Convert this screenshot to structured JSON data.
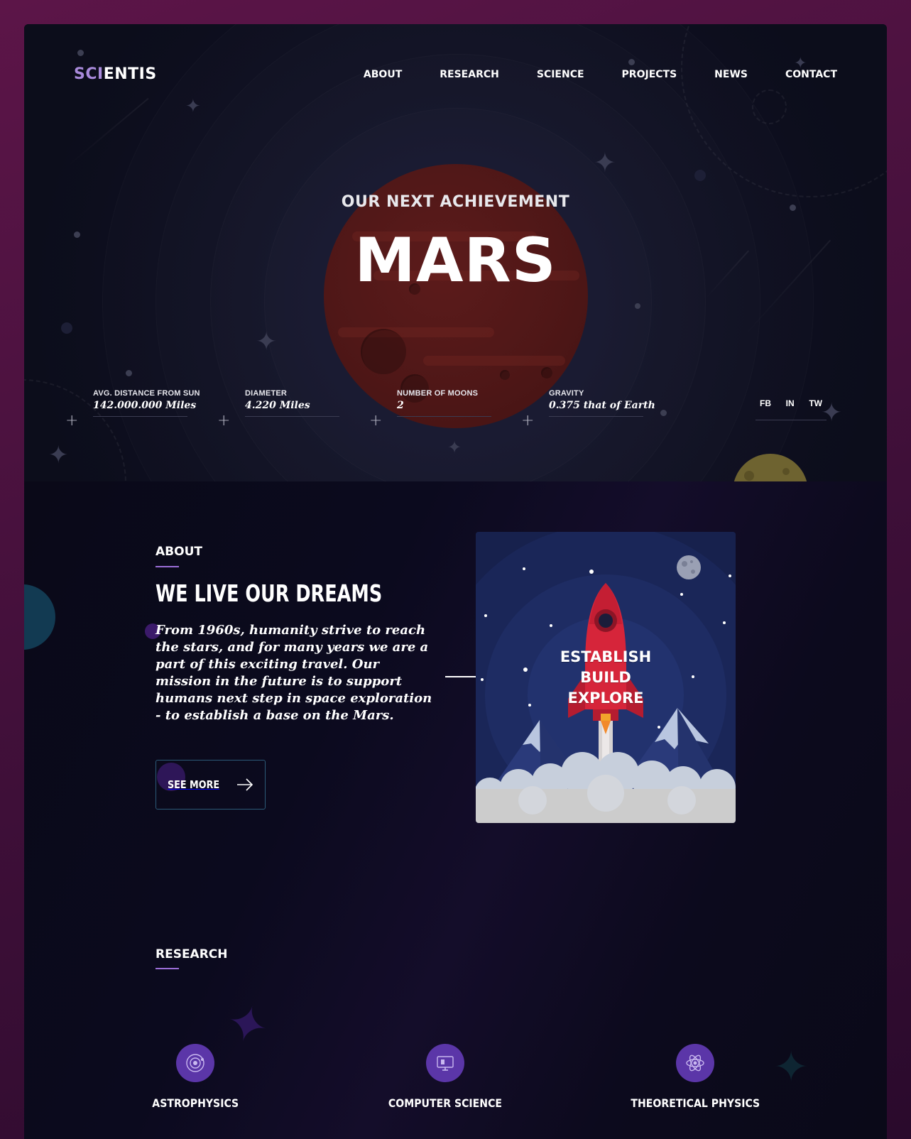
{
  "brand": {
    "logo_accent": "SCI",
    "logo_rest": "ENTIS",
    "accent_color": "#a98adb"
  },
  "nav": {
    "items": [
      "ABOUT",
      "RESEARCH",
      "SCIENCE",
      "PROJECTS",
      "NEWS",
      "CONTACT"
    ]
  },
  "hero": {
    "eyebrow": "OUR NEXT ACHIEVEMENT",
    "title": "MARS",
    "stats": [
      {
        "label": "AVG. DISTANCE FROM SUN",
        "value": "142.000.000 Miles"
      },
      {
        "label": "DIAMETER",
        "value": "4.220 Miles"
      },
      {
        "label": "NUMBER OF MOONS",
        "value": "2"
      },
      {
        "label": "GRAVITY",
        "value": "0.375 that of Earth"
      }
    ],
    "social": [
      "FB",
      "IN",
      "TW"
    ]
  },
  "about": {
    "label": "ABOUT",
    "heading": "WE LIVE OUR DREAMS",
    "text": "From 1960s, humanity strive to reach the stars, and for many years we are a part of this exciting travel. Our mission in the future is to support humans next step in space exploration - to establish a base on the Mars.",
    "button_label": "SEE MORE",
    "illustration_lines": [
      "ESTABLISH",
      "BUILD",
      "EXPLORE"
    ]
  },
  "research": {
    "label": "RESEARCH",
    "items": [
      {
        "name": "ASTROPHYSICS",
        "icon": "orbit-icon"
      },
      {
        "name": "COMPUTER SCIENCE",
        "icon": "computer-icon"
      },
      {
        "name": "THEORETICAL PHYSICS",
        "icon": "atom-icon"
      }
    ]
  },
  "colors": {
    "underline": "#9b6ed8",
    "icon_bg": "#5b36a8",
    "button_border": "#2c5a78",
    "planet": "#4f1717"
  }
}
